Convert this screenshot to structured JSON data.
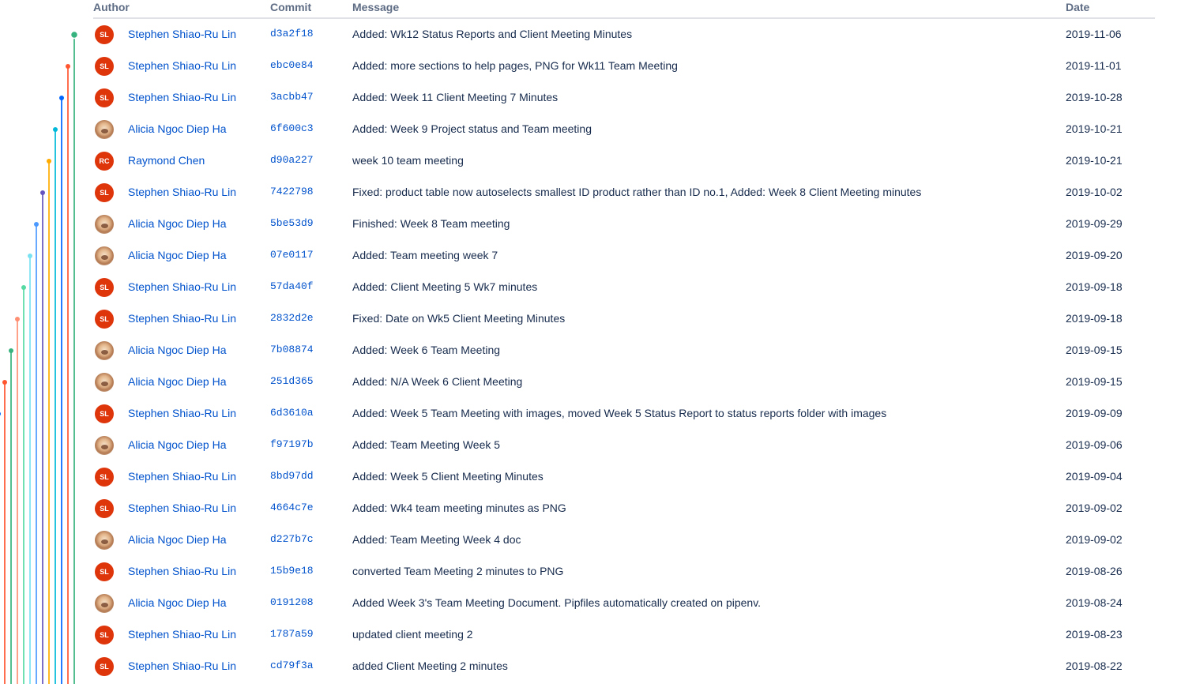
{
  "table": {
    "columns": {
      "author": "Author",
      "commit": "Commit",
      "message": "Message",
      "date": "Date"
    },
    "rows": [
      {
        "author": "Stephen Shiao-Ru Lin",
        "avatar": "SL",
        "avatar_type": "initials",
        "commit": "d3a2f18",
        "message": "Added: Wk12 Status Reports and Client Meeting Minutes",
        "date": "2019-11-06"
      },
      {
        "author": "Stephen Shiao-Ru Lin",
        "avatar": "SL",
        "avatar_type": "initials",
        "commit": "ebc0e84",
        "message": "Added: more sections to help pages, PNG for Wk11 Team Meeting",
        "date": "2019-11-01"
      },
      {
        "author": "Stephen Shiao-Ru Lin",
        "avatar": "SL",
        "avatar_type": "initials",
        "commit": "3acbb47",
        "message": "Added: Week 11 Client Meeting 7 Minutes",
        "date": "2019-10-28"
      },
      {
        "author": "Alicia Ngoc Diep Ha",
        "avatar": "",
        "avatar_type": "photo",
        "commit": "6f600c3",
        "message": "Added: Week 9 Project status and Team meeting",
        "date": "2019-10-21"
      },
      {
        "author": "Raymond Chen",
        "avatar": "RC",
        "avatar_type": "initials",
        "commit": "d90a227",
        "message": "week 10 team meeting",
        "date": "2019-10-21"
      },
      {
        "author": "Stephen Shiao-Ru Lin",
        "avatar": "SL",
        "avatar_type": "initials",
        "commit": "7422798",
        "message": "Fixed: product table now autoselects smallest ID product rather than ID no.1, Added: Week 8 Client Meeting minutes",
        "date": "2019-10-02"
      },
      {
        "author": "Alicia Ngoc Diep Ha",
        "avatar": "",
        "avatar_type": "photo",
        "commit": "5be53d9",
        "message": "Finished: Week 8 Team meeting",
        "date": "2019-09-29"
      },
      {
        "author": "Alicia Ngoc Diep Ha",
        "avatar": "",
        "avatar_type": "photo",
        "commit": "07e0117",
        "message": "Added: Team meeting week 7",
        "date": "2019-09-20"
      },
      {
        "author": "Stephen Shiao-Ru Lin",
        "avatar": "SL",
        "avatar_type": "initials",
        "commit": "57da40f",
        "message": "Added: Client Meeting 5 Wk7 minutes",
        "date": "2019-09-18"
      },
      {
        "author": "Stephen Shiao-Ru Lin",
        "avatar": "SL",
        "avatar_type": "initials",
        "commit": "2832d2e",
        "message": "Fixed: Date on Wk5 Client Meeting Minutes",
        "date": "2019-09-18"
      },
      {
        "author": "Alicia Ngoc Diep Ha",
        "avatar": "",
        "avatar_type": "photo",
        "commit": "7b08874",
        "message": "Added: Week 6 Team Meeting",
        "date": "2019-09-15"
      },
      {
        "author": "Alicia Ngoc Diep Ha",
        "avatar": "",
        "avatar_type": "photo",
        "commit": "251d365",
        "message": "Added: N/A Week 6 Client Meeting",
        "date": "2019-09-15"
      },
      {
        "author": "Stephen Shiao-Ru Lin",
        "avatar": "SL",
        "avatar_type": "initials",
        "commit": "6d3610a",
        "message": "Added: Week 5 Team Meeting with images, moved Week 5 Status Report to status reports folder with images",
        "date": "2019-09-09"
      },
      {
        "author": "Alicia Ngoc Diep Ha",
        "avatar": "",
        "avatar_type": "photo",
        "commit": "f97197b",
        "message": "Added: Team Meeting Week 5",
        "date": "2019-09-06"
      },
      {
        "author": "Stephen Shiao-Ru Lin",
        "avatar": "SL",
        "avatar_type": "initials",
        "commit": "8bd97dd",
        "message": "Added: Week 5 Client Meeting Minutes",
        "date": "2019-09-04"
      },
      {
        "author": "Stephen Shiao-Ru Lin",
        "avatar": "SL",
        "avatar_type": "initials",
        "commit": "4664c7e",
        "message": "Added: Wk4 team meeting minutes as PNG",
        "date": "2019-09-02"
      },
      {
        "author": "Alicia Ngoc Diep Ha",
        "avatar": "",
        "avatar_type": "photo",
        "commit": "d227b7c",
        "message": "Added: Team Meeting Week 4 doc",
        "date": "2019-09-02"
      },
      {
        "author": "Stephen Shiao-Ru Lin",
        "avatar": "SL",
        "avatar_type": "initials",
        "commit": "15b9e18",
        "message": "converted Team Meeting 2 minutes to PNG",
        "date": "2019-08-26"
      },
      {
        "author": "Alicia Ngoc Diep Ha",
        "avatar": "",
        "avatar_type": "photo",
        "commit": "0191208",
        "message": "Added Week 3's Team Meeting Document. Pipfiles automatically created on pipenv.",
        "date": "2019-08-24"
      },
      {
        "author": "Stephen Shiao-Ru Lin",
        "avatar": "SL",
        "avatar_type": "initials",
        "commit": "1787a59",
        "message": "updated client meeting 2",
        "date": "2019-08-23"
      },
      {
        "author": "Stephen Shiao-Ru Lin",
        "avatar": "SL",
        "avatar_type": "initials",
        "commit": "cd79f3a",
        "message": "added Client Meeting 2 minutes",
        "date": "2019-08-22"
      }
    ]
  },
  "colors": {
    "link": "#0052cc",
    "text": "#172b4d",
    "header": "#5e6c84",
    "avatar_initials_bg": "#de350b",
    "branch_palette": [
      "#36b37e",
      "#ff5630",
      "#0065ff",
      "#00b8d9",
      "#ffab00",
      "#6554c0",
      "#4c9aff",
      "#79e2f2",
      "#57d9a3",
      "#ff8f73"
    ]
  }
}
